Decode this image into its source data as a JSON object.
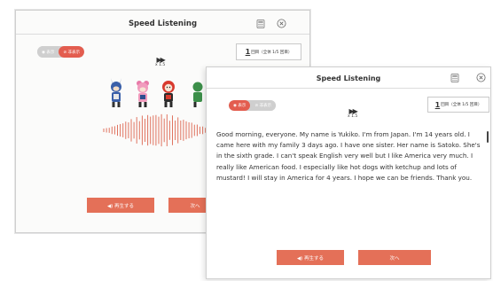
{
  "app_title": "Speed Listening",
  "colors": {
    "accent": "#e35d4f",
    "button": "#e47058",
    "toggle_off": "#cfcfcf"
  },
  "back_window": {
    "title": "Speed Listening",
    "toggle": {
      "show_label": "◉ 表示",
      "hide_label": "⊘ 非表示",
      "selected": "hide"
    },
    "counter": {
      "num": "1",
      "text": "回目（全体 1/5 回目）"
    },
    "speed": {
      "icon": "▶▶",
      "label": "x 1.5"
    },
    "play_button": "◀) 再生する",
    "next_button": "次へ"
  },
  "front_window": {
    "title": "Speed Listening",
    "toggle": {
      "show_label": "◉ 表示",
      "hide_label": "⊘ 非表示",
      "selected": "show"
    },
    "counter": {
      "num": "1",
      "text": "回目（全体 1/5 回目）"
    },
    "speed": {
      "icon": "▶▶",
      "label": "x 1.5"
    },
    "story_text": "Good morning, everyone. My name is Yukiko. I'm from Japan. I'm 14 years old. I came here with my family 3 days ago. I have one sister. Her name is Satoko. She's in the sixth grade. I can't speak English very well but I like America very much. I really like American food. I especially like hot dogs with ketchup and lots of mustard! I will stay in America for 4 years. I hope we can be friends. Thank you.",
    "play_button": "◀) 再生する",
    "next_button": "次へ"
  },
  "icons": [
    "calculator-icon",
    "close-icon",
    "fast-forward-icon",
    "speaker-icon",
    "eye-icon",
    "eye-off-icon"
  ]
}
